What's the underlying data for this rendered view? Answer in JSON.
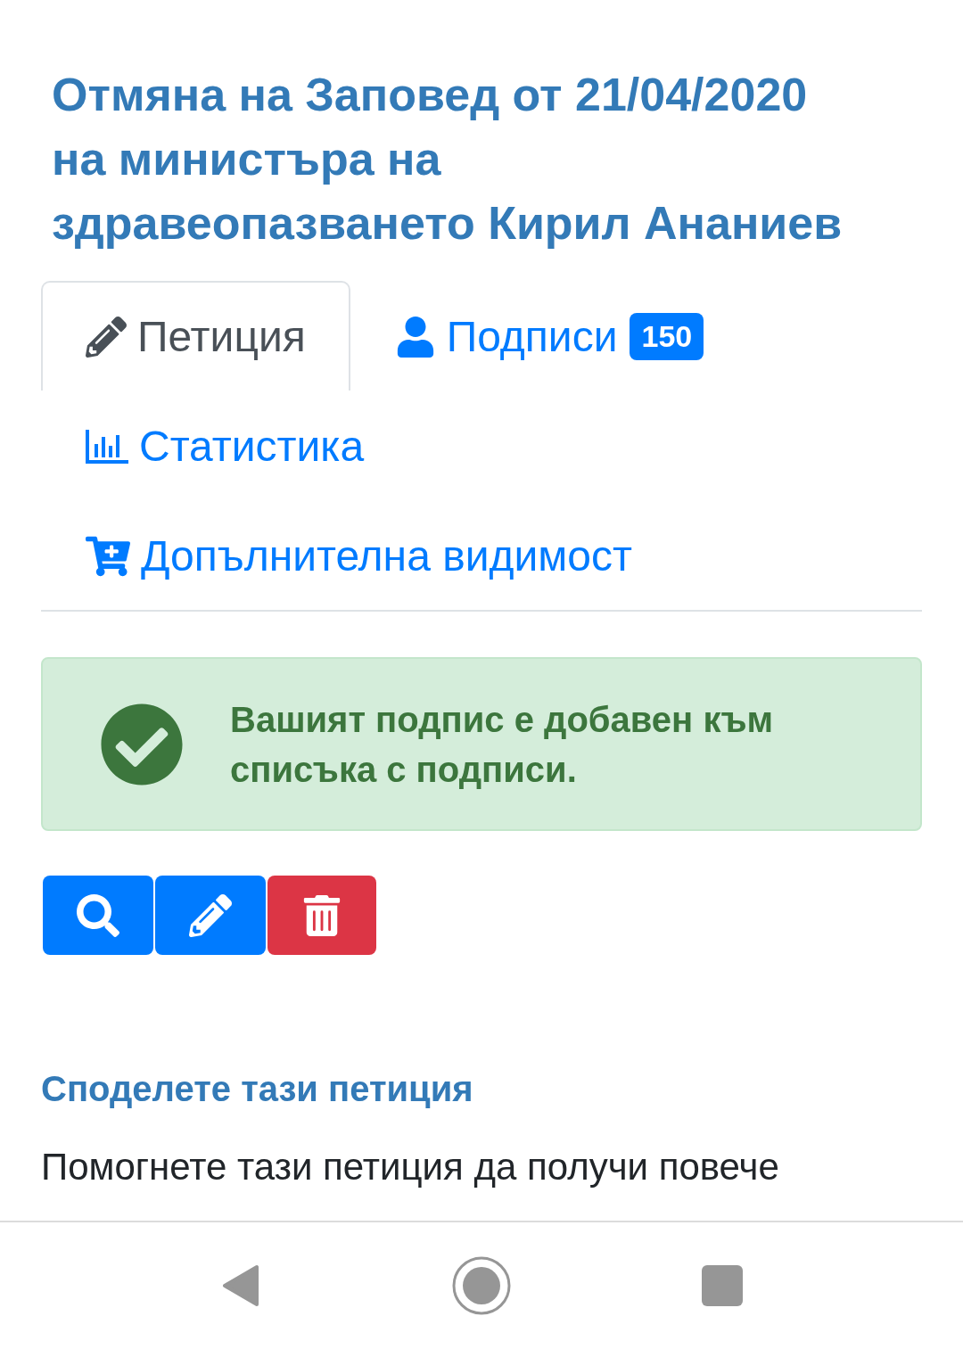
{
  "title": "Отмяна на Заповед от 21/04/2020 на министъра на здравеопазването Кирил Ананиев",
  "tabs": [
    {
      "kind": "petition",
      "label": "Петиция",
      "selected": true
    },
    {
      "kind": "signatures",
      "label": "Подписи",
      "badge": "150",
      "selected": false
    },
    {
      "kind": "statistics",
      "label": "Статистика",
      "selected": false
    },
    {
      "kind": "promotion",
      "label": "Допълнителна видимост",
      "selected": false
    }
  ],
  "alert": {
    "kind": "success",
    "message": "Вашият подпис е добавен към списъка с подписи."
  },
  "action_buttons": [
    {
      "kind": "view"
    },
    {
      "kind": "edit"
    },
    {
      "kind": "delete"
    }
  ],
  "share": {
    "heading": "Споделете тази петиция",
    "text": "Помогнете тази петиция да получи повече"
  }
}
